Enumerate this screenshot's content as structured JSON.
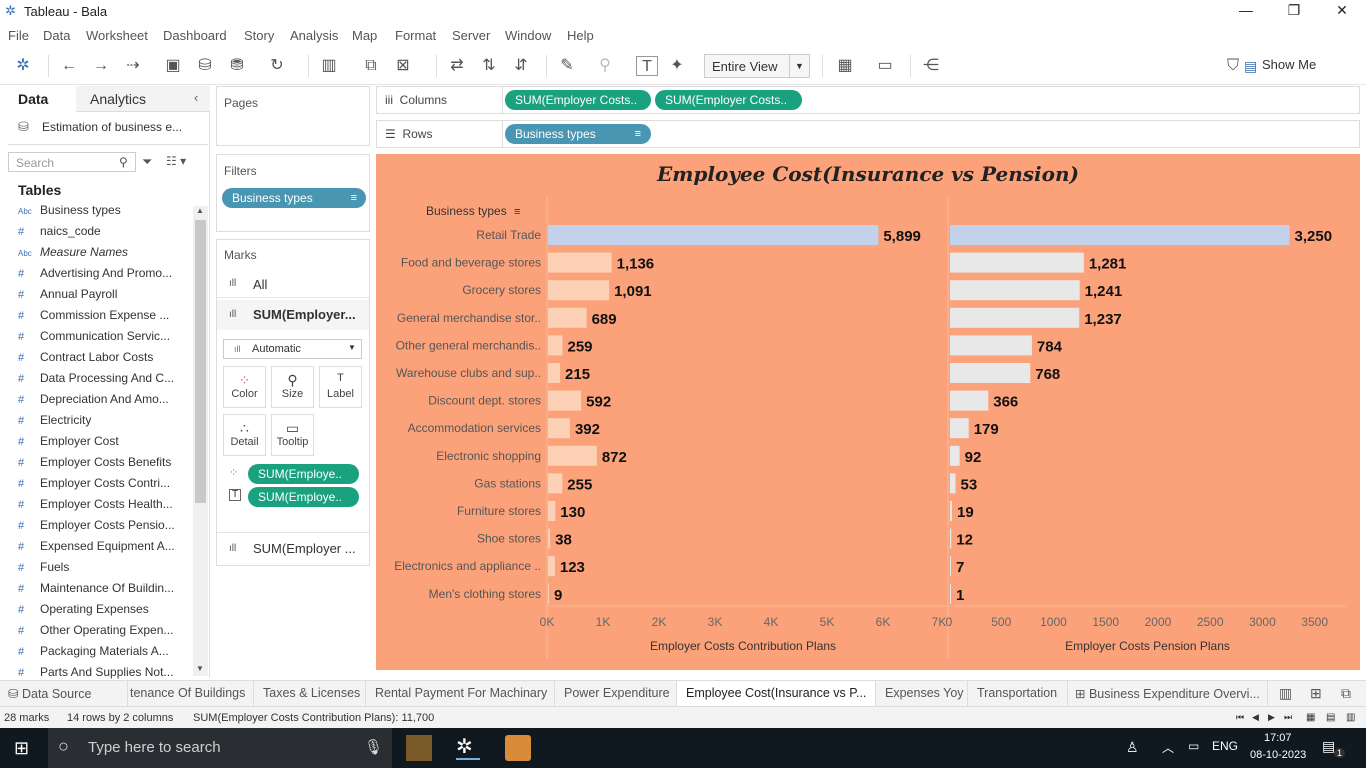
{
  "window": {
    "title": "Tableau - Bala"
  },
  "menu": [
    "File",
    "Data",
    "Worksheet",
    "Dashboard",
    "Story",
    "Analysis",
    "Map",
    "Format",
    "Server",
    "Window",
    "Help"
  ],
  "toolbar": {
    "view_select": "Entire View",
    "show_me": "Show Me"
  },
  "datapane": {
    "tab_data": "Data",
    "tab_analytics": "Analytics",
    "datasource": "Estimation of business e...",
    "search_placeholder": "Search",
    "tables_heading": "Tables",
    "fields": [
      {
        "type": "Abc",
        "name": "Business types"
      },
      {
        "type": "#",
        "name": "naics_code"
      },
      {
        "type": "Abc",
        "name": "Measure Names",
        "italic": true
      },
      {
        "type": "#",
        "name": "Advertising And Promo..."
      },
      {
        "type": "#",
        "name": "Annual Payroll"
      },
      {
        "type": "#",
        "name": "Commission Expense ..."
      },
      {
        "type": "#",
        "name": "Communication Servic..."
      },
      {
        "type": "#",
        "name": "Contract Labor Costs"
      },
      {
        "type": "#",
        "name": "Data Processing And C..."
      },
      {
        "type": "#",
        "name": "Depreciation And Amo..."
      },
      {
        "type": "#",
        "name": "Electricity"
      },
      {
        "type": "#",
        "name": "Employer Cost"
      },
      {
        "type": "#",
        "name": "Employer Costs Benefits"
      },
      {
        "type": "#",
        "name": "Employer Costs Contri..."
      },
      {
        "type": "#",
        "name": "Employer Costs Health..."
      },
      {
        "type": "#",
        "name": "Employer Costs Pensio..."
      },
      {
        "type": "#",
        "name": "Expensed Equipment A..."
      },
      {
        "type": "#",
        "name": "Fuels"
      },
      {
        "type": "#",
        "name": "Maintenance Of Buildin..."
      },
      {
        "type": "#",
        "name": "Operating Expenses"
      },
      {
        "type": "#",
        "name": "Other Operating Expen..."
      },
      {
        "type": "#",
        "name": "Packaging Materials A..."
      },
      {
        "type": "#",
        "name": "Parts And Supplies Not..."
      }
    ]
  },
  "cards": {
    "pages_title": "Pages",
    "filters_title": "Filters",
    "filter_pill": "Business types",
    "marks_title": "Marks",
    "marks_all": "All",
    "marks_sum1": "SUM(Employer...",
    "mark_type": "Automatic",
    "btn_color": "Color",
    "btn_size": "Size",
    "btn_label": "Label",
    "btn_detail": "Detail",
    "btn_tooltip": "Tooltip",
    "pill_color": "SUM(Employe..",
    "pill_label": "SUM(Employe..",
    "marks_sum2": "SUM(Employer ..."
  },
  "shelves": {
    "columns_label": "Columns",
    "rows_label": "Rows",
    "col_pill1": "SUM(Employer Costs..",
    "col_pill2": "SUM(Employer Costs..",
    "row_pill": "Business types"
  },
  "chart_data": {
    "type": "bar",
    "title": "Employee Cost(Insurance vs Pension)",
    "row_header": "Business types",
    "categories": [
      "Retail Trade",
      "Food and beverage stores",
      "Grocery stores",
      "General merchandise stor..",
      "Other general merchandis..",
      "Warehouse clubs and sup..",
      "Discount dept. stores",
      "Accommodation services",
      "Electronic shopping",
      "Gas stations",
      "Furniture stores",
      "Shoe stores",
      "Electronics and appliance ..",
      "Men's clothing stores"
    ],
    "series": [
      {
        "name": "Employer Costs Contribution Plans",
        "values": [
          5899,
          1136,
          1091,
          689,
          259,
          215,
          592,
          392,
          872,
          255,
          130,
          38,
          123,
          9
        ],
        "labels": [
          "5,899",
          "1,136",
          "1,091",
          "689",
          "259",
          "215",
          "592",
          "392",
          "872",
          "255",
          "130",
          "38",
          "123",
          "9"
        ],
        "xlim": [
          0,
          7000
        ],
        "ticks": [
          "0K",
          "1K",
          "2K",
          "3K",
          "4K",
          "5K",
          "6K",
          "7K"
        ]
      },
      {
        "name": "Employer Costs Pension Plans",
        "values": [
          3250,
          1281,
          1241,
          1237,
          784,
          768,
          366,
          179,
          92,
          53,
          19,
          12,
          7,
          1
        ],
        "labels": [
          "3,250",
          "1,281",
          "1,241",
          "1,237",
          "784",
          "768",
          "366",
          "179",
          "92",
          "53",
          "19",
          "12",
          "7",
          "1"
        ],
        "xlim": [
          0,
          3800
        ],
        "ticks": [
          "0",
          "500",
          "1000",
          "1500",
          "2000",
          "2500",
          "3000",
          "3500"
        ]
      }
    ],
    "colors": {
      "background": "#fca27a",
      "highlight": "#c3d2ea",
      "series1": "#fdd1b5",
      "series2": "#e8e8e8"
    }
  },
  "sheet_tabs": [
    "Data Source",
    "tenance Of Buildings",
    "Taxes & Licenses",
    "Rental Payment For Machinary",
    "Power Expenditure",
    "Employee Cost(Insurance vs P...",
    "Expenses Yoy",
    "Transportation",
    "Business Expenditure Overvi..."
  ],
  "status": {
    "marks": "28 marks",
    "dims": "14 rows by 2 columns",
    "sum": "SUM(Employer Costs Contribution Plans): 11,700"
  },
  "taskbar": {
    "search_placeholder": "Type here to search",
    "lang": "ENG",
    "time": "17:07",
    "date": "08-10-2023",
    "notif_count": "1"
  }
}
